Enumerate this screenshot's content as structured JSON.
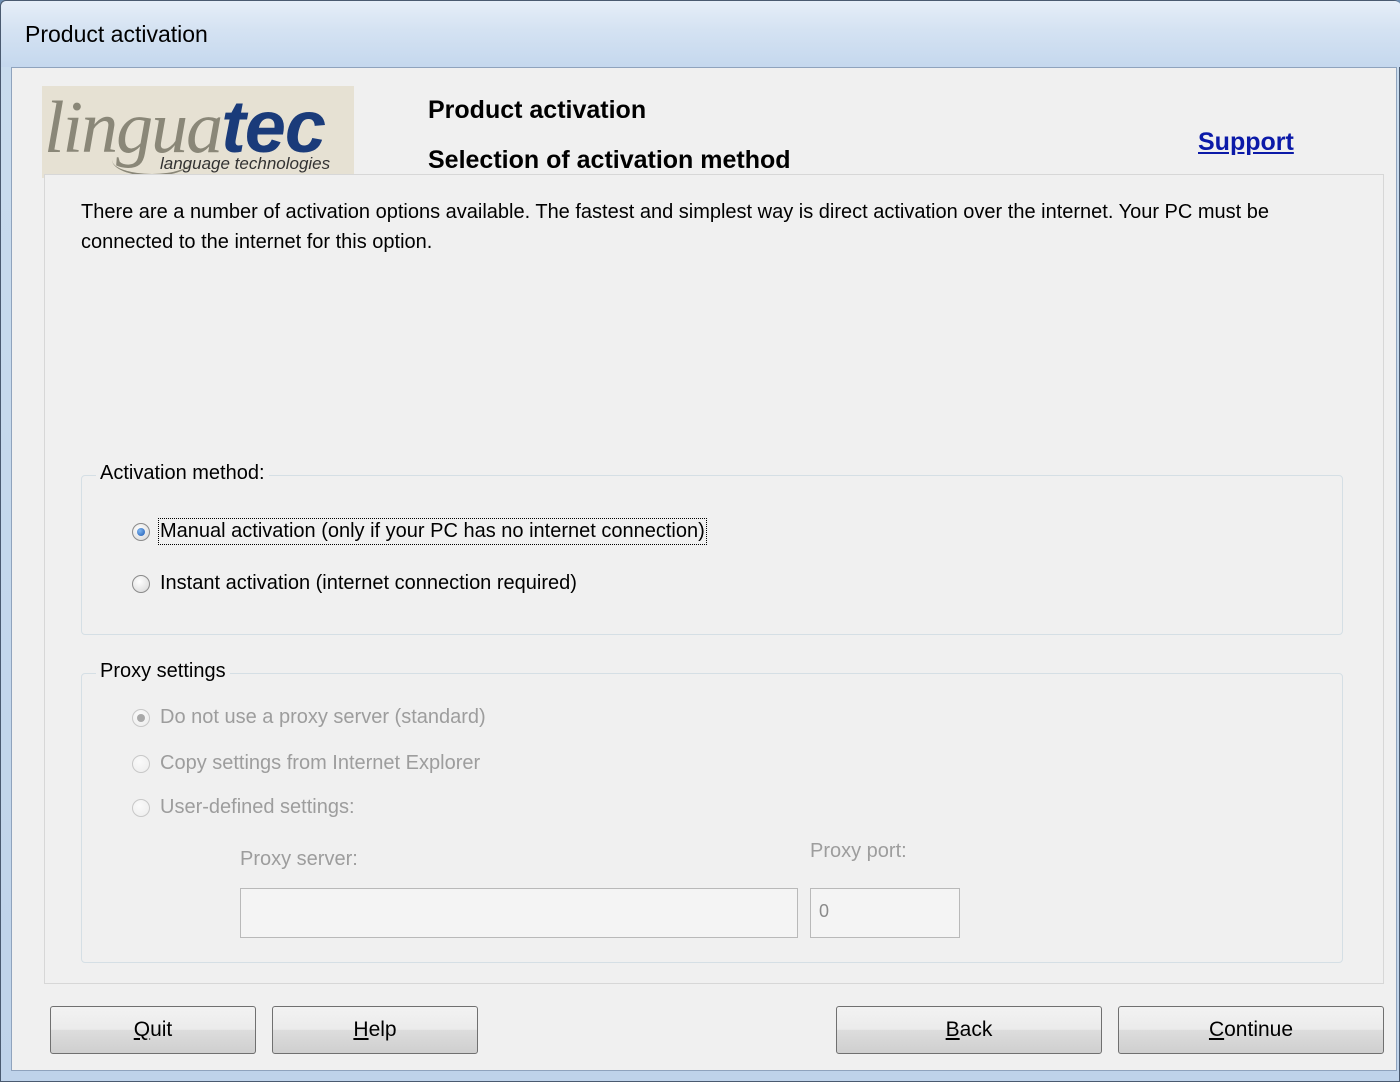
{
  "window": {
    "title": "Product activation"
  },
  "logo": {
    "brand_light": "lingua",
    "brand_bold": "tec",
    "tagline": "language technologies"
  },
  "header": {
    "title": "Product activation",
    "subtitle": "Selection of activation method",
    "support_link": "Support"
  },
  "description": "There are a number of activation options available. The fastest and simplest way is direct activation over the internet. Your PC must be connected to the internet for this option.",
  "activation": {
    "legend": "Activation method:",
    "options": [
      {
        "label": "Manual activation (only if your PC has no internet connection)",
        "selected": true
      },
      {
        "label": "Instant activation (internet connection required)",
        "selected": false
      }
    ]
  },
  "proxy": {
    "legend": "Proxy settings",
    "enabled": false,
    "options": [
      {
        "label": "Do not use a proxy server (standard)",
        "selected": true
      },
      {
        "label": "Copy settings from Internet Explorer",
        "selected": false
      },
      {
        "label": "User-defined settings:",
        "selected": false
      }
    ],
    "server_label": "Proxy server:",
    "server_value": "",
    "port_label": "Proxy port:",
    "port_value": "0"
  },
  "buttons": {
    "quit": {
      "mnemonic": "Q",
      "rest": "uit"
    },
    "help": {
      "mnemonic": "H",
      "rest": "elp"
    },
    "back": {
      "mnemonic": "B",
      "rest": "ack"
    },
    "continue": {
      "mnemonic": "C",
      "rest": "ontinue"
    }
  }
}
